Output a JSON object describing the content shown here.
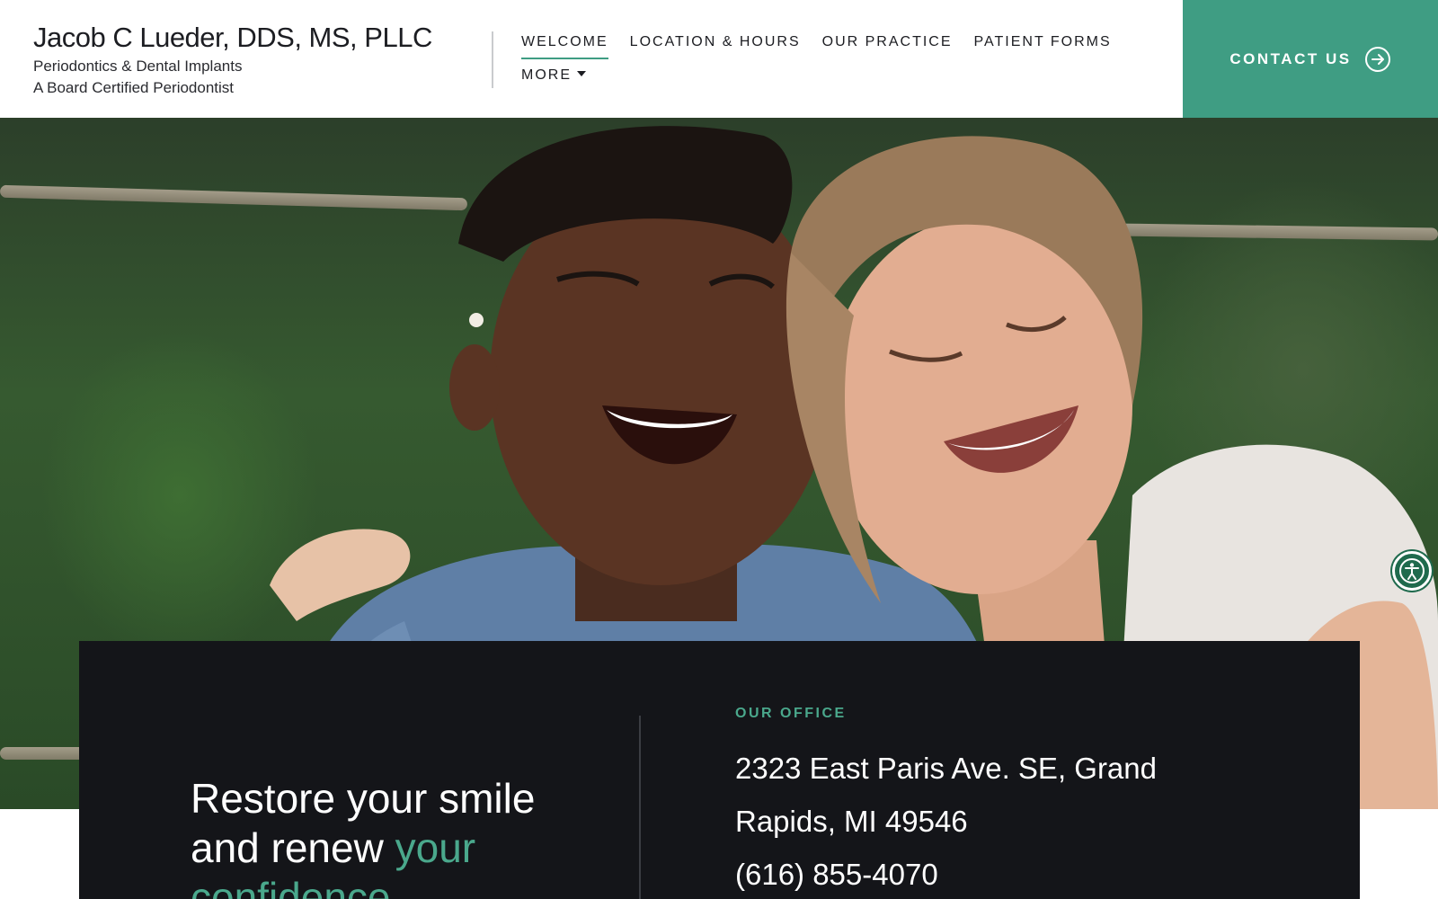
{
  "header": {
    "brand_name": "Jacob C Lueder, DDS, MS, PLLC",
    "brand_subtitle_1": "Periodontics & Dental Implants",
    "brand_subtitle_2": "A Board Certified Periodontist",
    "nav": [
      {
        "label": "WELCOME",
        "active": true
      },
      {
        "label": "LOCATION & HOURS",
        "active": false
      },
      {
        "label": "OUR PRACTICE",
        "active": false
      },
      {
        "label": "PATIENT FORMS",
        "active": false
      },
      {
        "label": "MORE",
        "active": false
      }
    ],
    "cta_label": "CONTACT US"
  },
  "hero": {
    "image_icon": "photo-two-women-smiling"
  },
  "panel": {
    "tagline_main": "Restore your smile and renew ",
    "tagline_accent": "your confidence",
    "office_label": "OUR OFFICE",
    "office_address": "2323 East Paris Ave. SE, Grand Rapids, MI 49546",
    "office_phone": "(616) 855-4070"
  },
  "accessibility": {
    "icon": "accessibility-icon"
  },
  "colors": {
    "accent": "#3f9d83",
    "panel_bg": "#141519",
    "accent_text": "#4aa88c"
  }
}
